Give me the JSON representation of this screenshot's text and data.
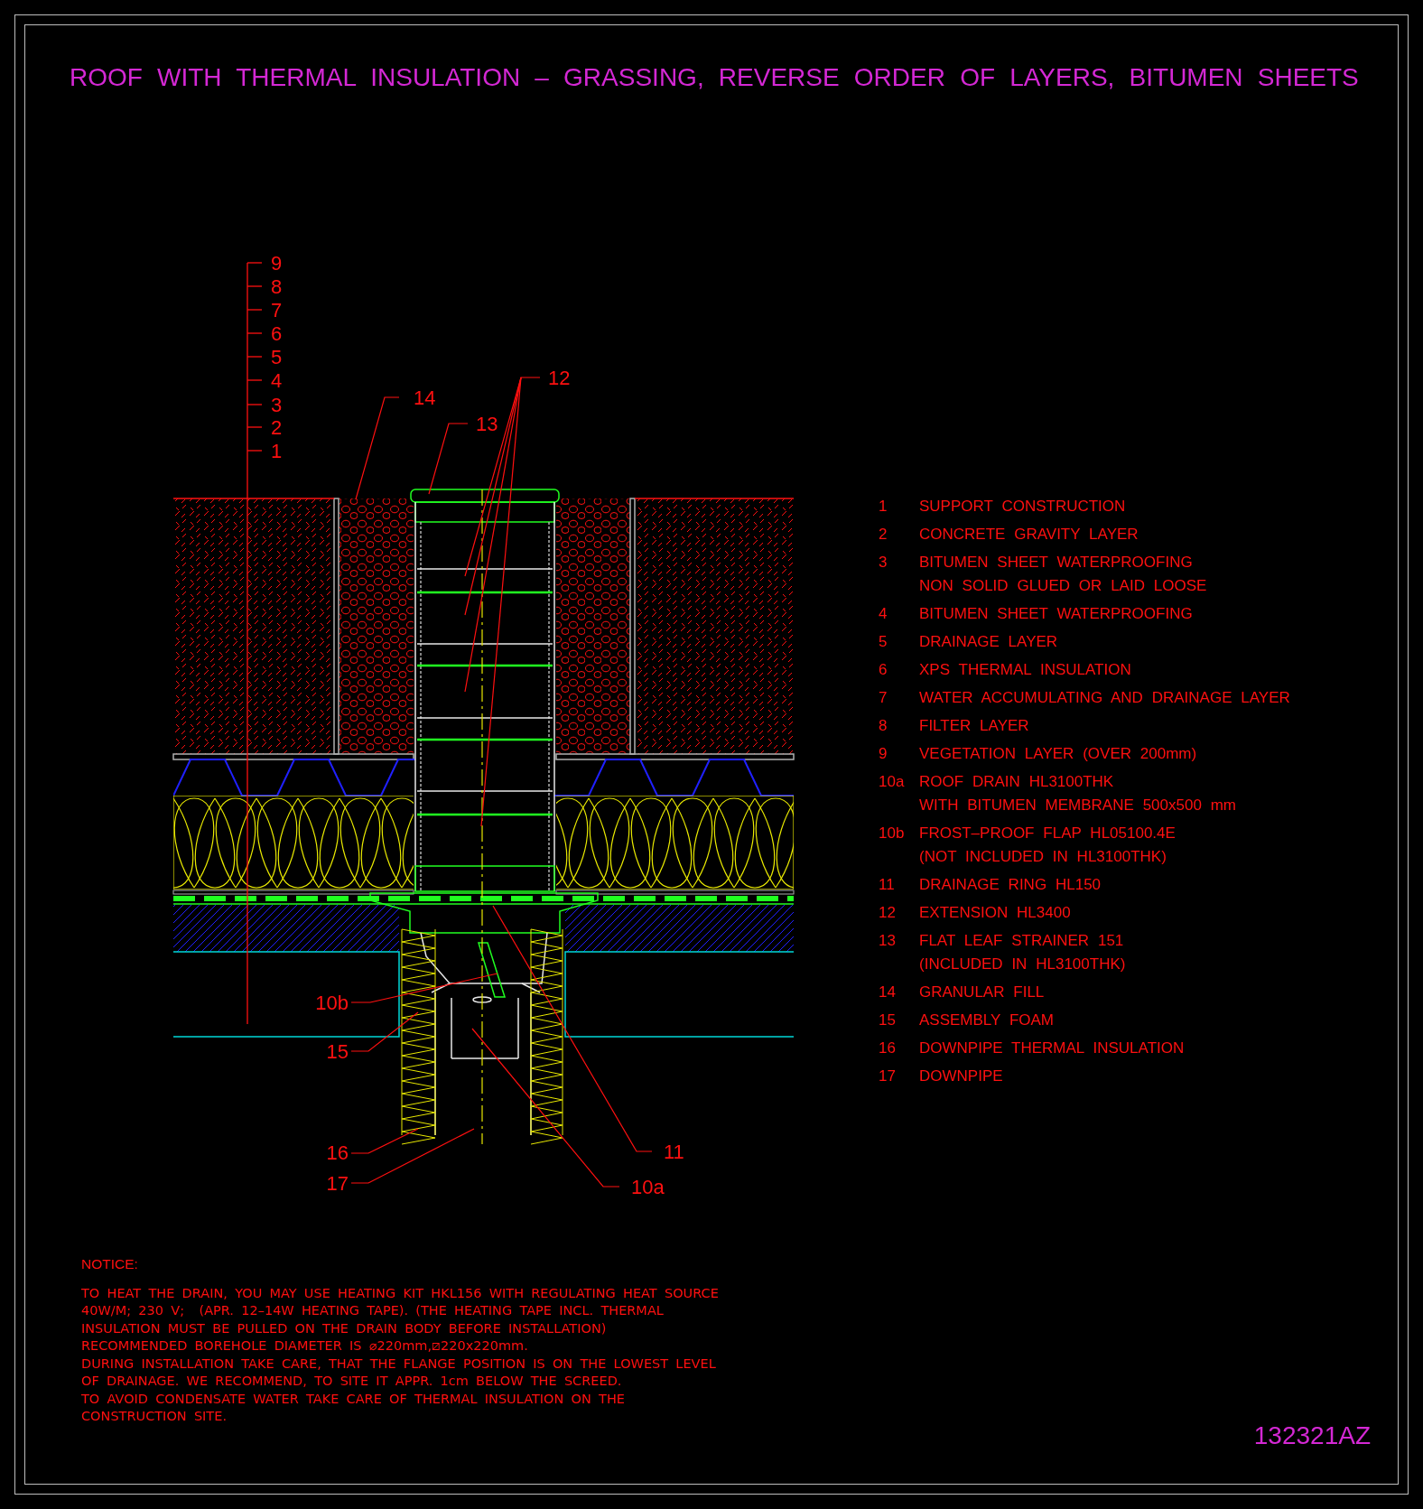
{
  "title": "ROOF WITH THERMAL INSULATION – GRASSING, REVERSE ORDER OF LAYERS, BITUMEN SHEETS",
  "drawing": {
    "layer_scale": [
      "9",
      "8",
      "7",
      "6",
      "5",
      "4",
      "3",
      "2",
      "1"
    ],
    "callouts": [
      "14",
      "13",
      "12",
      "10b",
      "15",
      "16",
      "17",
      "11",
      "10a"
    ]
  },
  "legend": [
    {
      "number": "1",
      "lines": [
        "SUPPORT CONSTRUCTION"
      ]
    },
    {
      "number": "2",
      "lines": [
        "CONCRETE GRAVITY LAYER"
      ]
    },
    {
      "number": "3",
      "lines": [
        "BITUMEN SHEET WATERPROOFING",
        "NON SOLID GLUED OR LAID LOOSE"
      ]
    },
    {
      "number": "4",
      "lines": [
        "BITUMEN SHEET WATERPROOFING"
      ]
    },
    {
      "number": "5",
      "lines": [
        "DRAINAGE LAYER"
      ]
    },
    {
      "number": "6",
      "lines": [
        "XPS THERMAL INSULATION"
      ]
    },
    {
      "number": "7",
      "lines": [
        "WATER ACCUMULATING AND DRAINAGE LAYER"
      ]
    },
    {
      "number": "8",
      "lines": [
        "FILTER LAYER"
      ]
    },
    {
      "number": "9",
      "lines": [
        "VEGETATION LAYER (OVER 200mm)"
      ]
    },
    {
      "number": "10a",
      "lines": [
        "ROOF DRAIN HL3100THK",
        "WITH BITUMEN MEMBRANE 500x500 mm"
      ]
    },
    {
      "number": "10b",
      "lines": [
        "FROST–PROOF FLAP HL05100.4E",
        "(NOT INCLUDED IN HL3100THK)"
      ]
    },
    {
      "number": "11",
      "lines": [
        "DRAINAGE RING HL150"
      ]
    },
    {
      "number": "12",
      "lines": [
        "EXTENSION HL3400"
      ]
    },
    {
      "number": "13",
      "lines": [
        "FLAT LEAF STRAINER 151",
        "(INCLUDED IN HL3100THK)"
      ]
    },
    {
      "number": "14",
      "lines": [
        "GRANULAR FILL"
      ]
    },
    {
      "number": "15",
      "lines": [
        "ASSEMBLY FOAM"
      ]
    },
    {
      "number": "16",
      "lines": [
        "DOWNPIPE THERMAL INSULATION"
      ]
    },
    {
      "number": "17",
      "lines": [
        "DOWNPIPE"
      ]
    }
  ],
  "notice": {
    "heading": "NOTICE:",
    "lines": [
      "TO HEAT THE DRAIN, YOU MAY USE HEATING KIT HKL156 WITH REGULATING HEAT SOURCE",
      "40W/M; 230 V;  (APR. 12–14W HEATING TAPE). (THE HEATING TAPE INCL. THERMAL",
      "INSULATION MUST BE PULLED ON THE DRAIN BODY BEFORE INSTALLATION)",
      "RECOMMENDED BOREHOLE DIAMETER IS ⌀220mm,⧄220x220mm.",
      "DURING INSTALLATION TAKE CARE, THAT THE FLANGE POSITION IS ON THE LOWEST LEVEL",
      "OF DRAINAGE. WE RECOMMEND, TO SITE IT APPR. 1cm BELOW THE SCREED.",
      "TO AVOID CONDENSATE WATER TAKE CARE OF THERMAL INSULATION ON THE",
      "CONSTRUCTION SITE."
    ]
  },
  "drawing_number": "132321AZ"
}
